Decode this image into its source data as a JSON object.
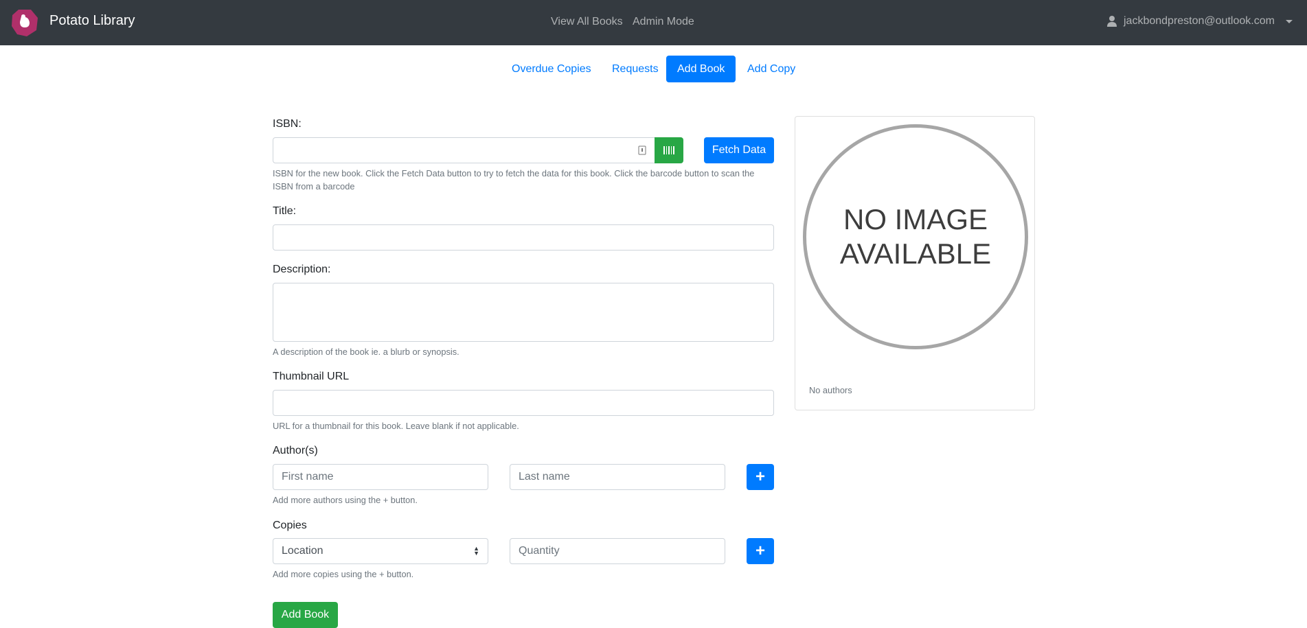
{
  "navbar": {
    "brand": "Potato Library",
    "links": [
      "View All Books",
      "Admin Mode"
    ],
    "user_email": "jackbondpreston@outlook.com"
  },
  "tabs": [
    {
      "label": "Overdue Copies",
      "active": false
    },
    {
      "label": "Requests",
      "active": false
    },
    {
      "label": "Add Book",
      "active": true
    },
    {
      "label": "Add Copy",
      "active": false
    }
  ],
  "form": {
    "isbn": {
      "label": "ISBN:",
      "value": "",
      "help": "ISBN for the new book. Click the Fetch Data button to try to fetch the data for this book. Click the barcode button to scan the ISBN from a barcode",
      "fetch_label": "Fetch Data"
    },
    "title": {
      "label": "Title:",
      "value": ""
    },
    "description": {
      "label": "Description:",
      "value": "",
      "help": "A description of the book ie. a blurb or synopsis."
    },
    "thumbnail": {
      "label": "Thumbnail URL",
      "value": "",
      "help": "URL for a thumbnail for this book. Leave blank if not applicable."
    },
    "authors": {
      "label": "Author(s)",
      "first_placeholder": "First name",
      "last_placeholder": "Last name",
      "add_label": "+",
      "help": "Add more authors using the + button."
    },
    "copies": {
      "label": "Copies",
      "location_selected": "Location",
      "quantity_placeholder": "Quantity",
      "add_label": "+",
      "help": "Add more copies using the + button."
    },
    "submit_label": "Add Book"
  },
  "preview": {
    "image_text_1": "NO IMAGE",
    "image_text_2": "AVAILABLE",
    "authors": "No authors"
  },
  "colors": {
    "primary": "#007bff",
    "success": "#28a745",
    "navbar": "#343a40",
    "logo": "#b0306a"
  }
}
